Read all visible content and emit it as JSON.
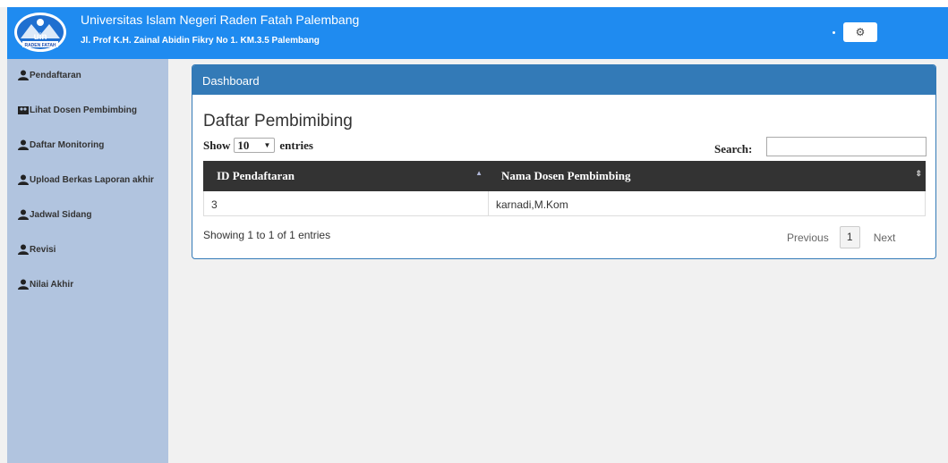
{
  "header": {
    "title": "Universitas Islam Negeri Raden Fatah Palembang",
    "address": "Jl. Prof K.H. Zainal Abidin Fikry No 1. KM.3.5 Palembang",
    "logo_text": "uin",
    "logo_subtext": "RADEN FATAH",
    "settings_icon": "⚙"
  },
  "sidebar": {
    "items": [
      {
        "label": "Pendaftaran",
        "icon": "user-icon"
      },
      {
        "label": "Lihat Dosen Pembimbing",
        "icon": "group-icon"
      },
      {
        "label": "Daftar Monitoring",
        "icon": "user-icon"
      },
      {
        "label": "Upload Berkas Laporan akhir",
        "icon": "user-icon"
      },
      {
        "label": "Jadwal Sidang",
        "icon": "user-icon"
      },
      {
        "label": "Revisi",
        "icon": "user-icon"
      },
      {
        "label": "Nilai Akhir",
        "icon": "user-icon"
      }
    ]
  },
  "panel": {
    "heading": "Dashboard",
    "section_title": "Daftar Pembimibing",
    "show_label": "Show",
    "entries_value": "10",
    "entries_label": "entries",
    "search_label": "Search:",
    "search_value": ""
  },
  "table": {
    "columns": [
      "ID Pendaftaran",
      "Nama Dosen Pembimbing"
    ],
    "rows": [
      [
        "3",
        "karnadi,M.Kom"
      ]
    ]
  },
  "footer": {
    "info": "Showing 1 to 1 of 1 entries",
    "previous": "Previous",
    "current_page": "1",
    "next": "Next"
  },
  "colors": {
    "header_bg": "#1f8bf0",
    "sidebar_bg": "#b1c4df",
    "panel_primary": "#337ab7",
    "table_head_bg": "#333333"
  }
}
